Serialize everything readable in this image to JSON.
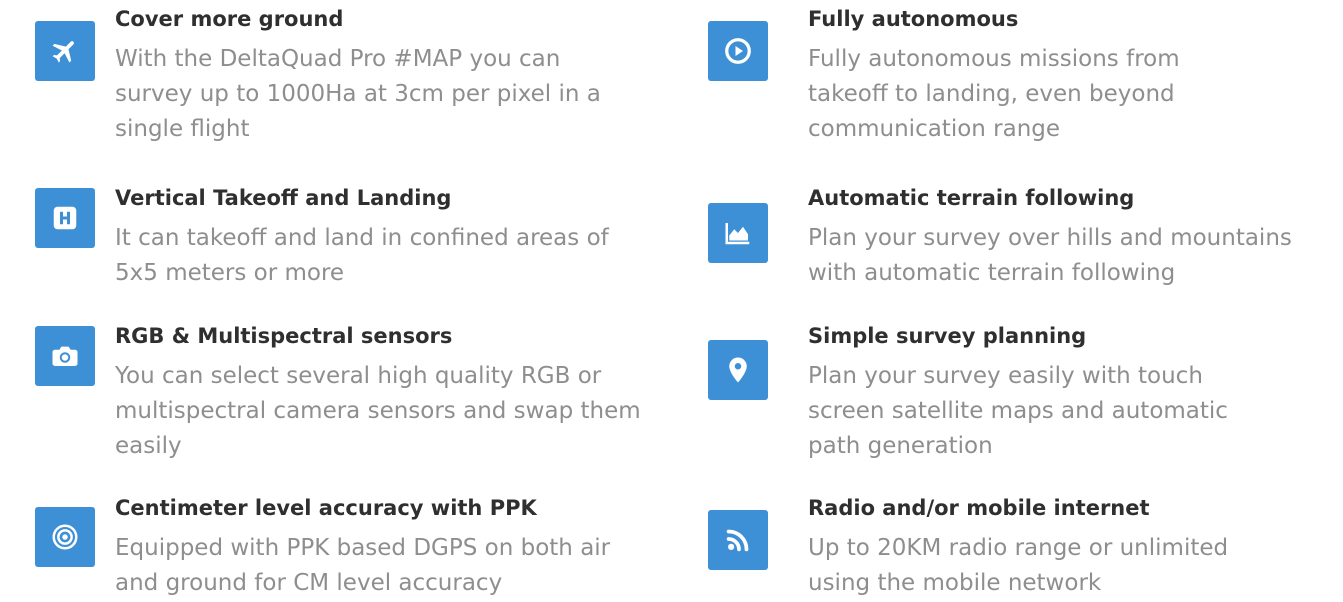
{
  "colors": {
    "accent": "#3d8fd6",
    "title_text": "#2f2f2f",
    "body_text": "#8e8e8e"
  },
  "features": [
    {
      "icon": "airplane-icon",
      "title": "Cover more ground",
      "description": "With the DeltaQuad Pro #MAP you can survey up to 1000Ha at 3cm per pixel in a single flight"
    },
    {
      "icon": "play-circle-icon",
      "title": "Fully autonomous",
      "description": "Fully autonomous missions from takeoff to landing, even beyond communication range"
    },
    {
      "icon": "helipad-h-icon",
      "title": "Vertical Takeoff and Landing",
      "description": "It can takeoff and land in confined areas of 5x5 meters or more"
    },
    {
      "icon": "terrain-chart-icon",
      "title": "Automatic terrain following",
      "description": "Plan your survey over hills and mountains with automatic terrain following"
    },
    {
      "icon": "camera-icon",
      "title": "RGB & Multispectral sensors",
      "description": "You can select several high quality RGB or multispectral camera sensors and swap them easily"
    },
    {
      "icon": "map-marker-icon",
      "title": "Simple survey planning",
      "description": "Plan your survey easily with touch screen satellite maps and automatic path generation"
    },
    {
      "icon": "target-icon",
      "title": "Centimeter level accuracy with PPK",
      "description": "Equipped with PPK based DGPS on both air and ground for CM level accuracy"
    },
    {
      "icon": "rss-feed-icon",
      "title": "Radio and/or mobile internet",
      "description": "Up to 20KM radio range or unlimited using the mobile network"
    }
  ]
}
